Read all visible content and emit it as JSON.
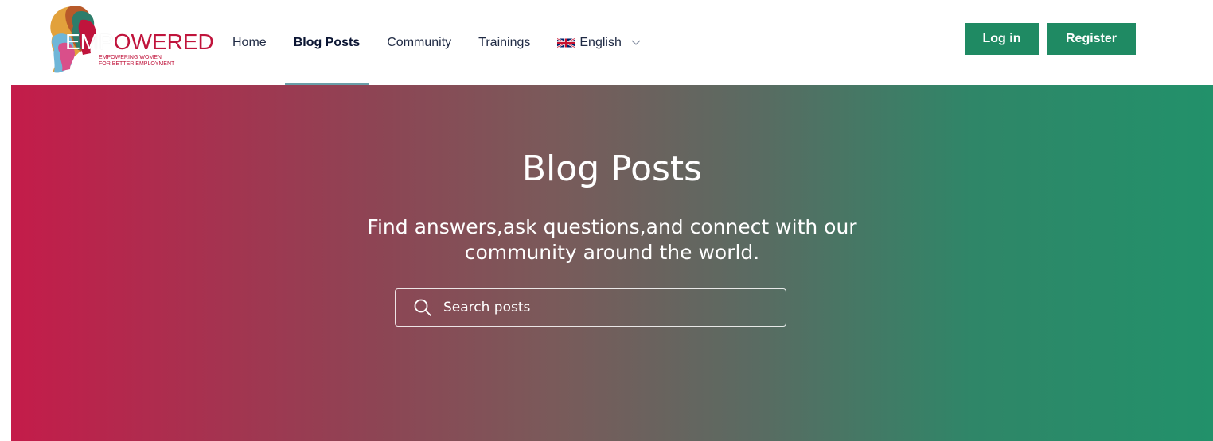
{
  "logo": {
    "word_emp": "EMP",
    "word_rest": "OWERED",
    "tagline_line1": "EMPOWERING WOMEN",
    "tagline_line2": "FOR BETTER EMPLOYMENT",
    "brand_color": "#c0143c"
  },
  "nav": {
    "items": [
      {
        "label": "Home",
        "active": false
      },
      {
        "label": "Blog Posts",
        "active": true
      },
      {
        "label": "Community",
        "active": false
      },
      {
        "label": "Trainings",
        "active": false
      }
    ],
    "language": {
      "label": "English",
      "icon": "uk-flag-icon"
    }
  },
  "header_actions": {
    "login_label": "Log in",
    "register_label": "Register",
    "button_color": "#1f8a63"
  },
  "hero": {
    "title": "Blog Posts",
    "subtitle_line1": "Find answers,ask questions,and connect with our",
    "subtitle_line2": "community around the world.",
    "search_placeholder": "Search posts",
    "gradient_start": "#c41c4a",
    "gradient_end": "#22916a"
  }
}
